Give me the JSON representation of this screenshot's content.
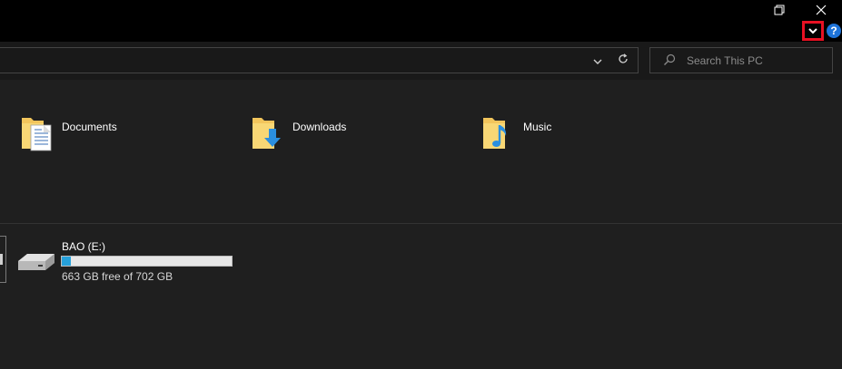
{
  "window": {
    "buttons": [
      "restore-button",
      "close-button"
    ],
    "ribbon_toggle": "chevron-down-icon",
    "help_label": "?"
  },
  "navbar": {
    "search_placeholder": "Search This PC"
  },
  "folders": [
    {
      "label": "Documents",
      "icon": "documents-folder-icon"
    },
    {
      "label": "Downloads",
      "icon": "downloads-folder-icon"
    },
    {
      "label": "Music",
      "icon": "music-folder-icon"
    }
  ],
  "drive": {
    "name": "BAO (E:)",
    "free_text": "663 GB free of 702 GB",
    "used_fraction": 0.0556
  },
  "colors": {
    "accent": "#26a0da",
    "highlight": "#e81123",
    "help": "#1e73d8"
  }
}
